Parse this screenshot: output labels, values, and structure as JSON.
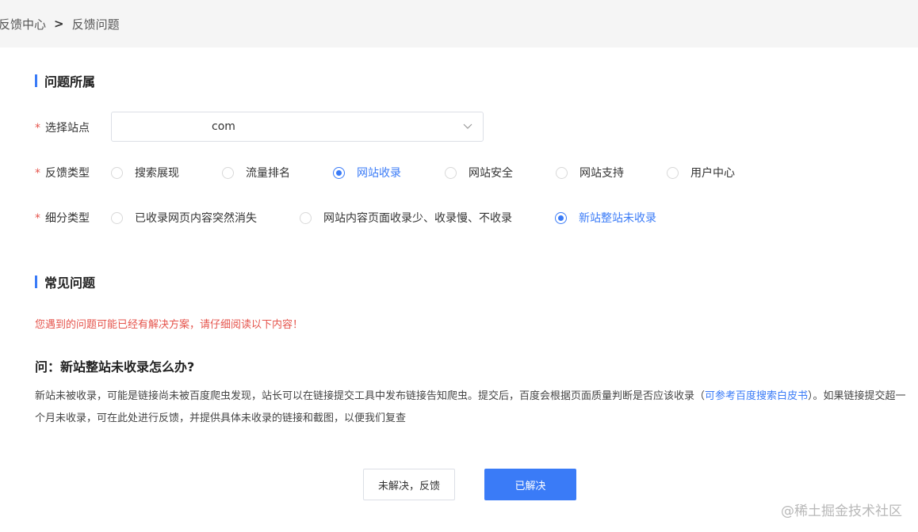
{
  "breadcrumb": {
    "parent": "反馈中心",
    "separator": ">",
    "current": "反馈问题"
  },
  "section_problem": {
    "title": "问题所属"
  },
  "site_select": {
    "label": "选择站点",
    "required_mark": "*",
    "value": "com"
  },
  "feedback_type": {
    "label": "反馈类型",
    "required_mark": "*",
    "options": [
      "搜索展现",
      "流量排名",
      "网站收录",
      "网站安全",
      "网站支持",
      "用户中心"
    ],
    "selected": "网站收录"
  },
  "sub_type": {
    "label": "细分类型",
    "required_mark": "*",
    "options": [
      "已收录网页内容突然消失",
      "网站内容页面收录少、收录慢、不收录",
      "新站整站未收录"
    ],
    "selected": "新站整站未收录"
  },
  "section_faq": {
    "title": "常见问题"
  },
  "faq": {
    "notice": "您遇到的问题可能已经有解决方案，请仔细阅读以下内容！",
    "question": "问：新站整站未收录怎么办?",
    "answer_part1": "新站未被收录，可能是链接尚未被百度爬虫发现，站长可以在链接提交工具中发布链接告知爬虫。提交后，百度会根据页面质量判断是否应该收录（",
    "answer_link": "可参考百度搜索白皮书",
    "answer_part2": "）。如果链接提交超一个月未收录，可在此处进行反馈，并提供具体未收录的链接和截图，以便我们复查"
  },
  "actions": {
    "unresolved_label": "未解决，反馈",
    "resolved_label": "已解决"
  },
  "watermark": "@稀土掘金技术社区",
  "colors": {
    "accent": "#3a7bf7",
    "required": "#e5534b",
    "topbar": "#f5f5f5"
  }
}
